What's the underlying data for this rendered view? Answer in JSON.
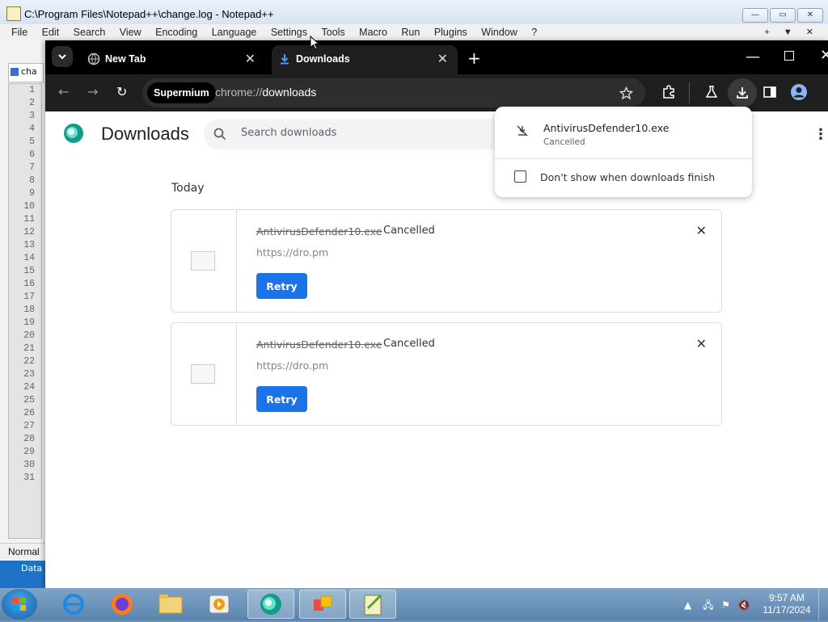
{
  "notepad": {
    "title": "C:\\Program Files\\Notepad++\\change.log - Notepad++",
    "menu": [
      "File",
      "Edit",
      "Search",
      "View",
      "Encoding",
      "Language",
      "Settings",
      "Tools",
      "Macro",
      "Run",
      "Plugins",
      "Window",
      "?"
    ],
    "menu_right": [
      "+",
      "▼",
      "✕"
    ],
    "tab_stub": "cha",
    "line_numbers": [
      "1",
      "2",
      "3",
      "4",
      "5",
      "6",
      "7",
      "8",
      "9",
      "10",
      "11",
      "12",
      "13",
      "14",
      "15",
      "16",
      "17",
      "18",
      "19",
      "20",
      "21",
      "22",
      "23",
      "24",
      "25",
      "26",
      "27",
      "28",
      "29",
      "30",
      "31"
    ],
    "status_mode": "Normal",
    "bottom_stub": "Data"
  },
  "browser": {
    "tabs": [
      {
        "label": "New Tab",
        "icon": "globe-icon"
      },
      {
        "label": "Downloads",
        "icon": "download-icon",
        "active": true
      }
    ],
    "omnibox": {
      "chip": "Supermium",
      "url_scheme": "chrome://",
      "url_path": "downloads"
    }
  },
  "downloads_page": {
    "title": "Downloads",
    "search_placeholder": "Search downloads",
    "section": "Today",
    "items": [
      {
        "filename": "AntivirusDefender10.exe",
        "status": "Cancelled",
        "source": "https://dro.pm",
        "action": "Retry"
      },
      {
        "filename": "AntivirusDefender10.exe",
        "status": "Cancelled",
        "source": "https://dro.pm",
        "action": "Retry"
      }
    ]
  },
  "bubble": {
    "filename": "AntivirusDefender10.exe",
    "status": "Cancelled",
    "checkbox_label": "Don't show when downloads finish",
    "checked": false
  },
  "taskbar": {
    "time": "9:57 AM",
    "date": "11/17/2024"
  },
  "colors": {
    "accent": "#1a73e8",
    "browser_frame": "#000000",
    "toolbar": "#1f1f1f"
  }
}
